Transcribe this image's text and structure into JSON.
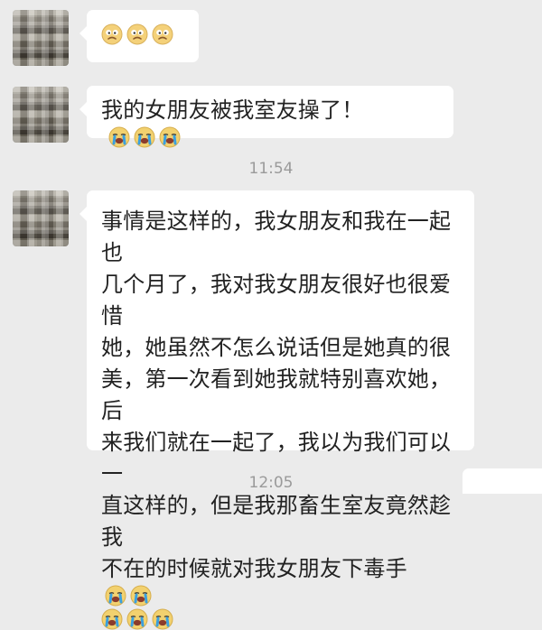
{
  "chat": {
    "messages": [
      {
        "type": "emoji_only",
        "emoji": [
          "worried-face",
          "worried-face",
          "worried-face"
        ]
      },
      {
        "type": "text",
        "text": "我的女朋友被我室友操了！",
        "emoji": [
          "crying-face",
          "crying-face",
          "crying-face"
        ]
      },
      {
        "type": "timestamp",
        "text": "11:54"
      },
      {
        "type": "text_block",
        "lines": [
          "事情是这样的，我女朋友和我在一起也",
          "几个月了，我对我女朋友很好也很爱惜",
          "她，她虽然不怎么说话但是她真的很",
          "美，第一次看到她我就特别喜欢她，后",
          "来我们就在一起了，我以为我们可以一",
          "直这样的，但是我那畜生室友竟然趁我",
          "不在的时候就对我女朋友下毒手"
        ],
        "inline_emoji_after_last_line": [
          "crying-face",
          "crying-face"
        ],
        "emoji_line": [
          "crying-face",
          "crying-face",
          "crying-face"
        ]
      },
      {
        "type": "timestamp",
        "text": "12:05"
      }
    ]
  },
  "colors": {
    "background": "#ebebeb",
    "bubble": "#ffffff",
    "text": "#222222",
    "timestamp": "#9a9a9a"
  }
}
